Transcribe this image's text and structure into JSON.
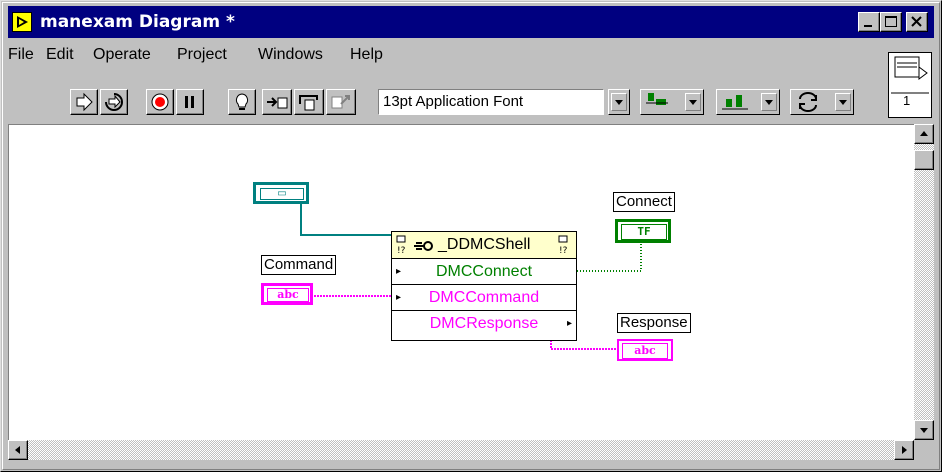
{
  "window": {
    "title": "manexam Diagram *"
  },
  "menu": {
    "items": [
      "File",
      "Edit",
      "Operate",
      "Project",
      "Windows",
      "Help"
    ]
  },
  "toolbar": {
    "icons": [
      "run-icon",
      "run-continuously-icon",
      "abort-icon",
      "pause-icon",
      "highlight-execution-icon",
      "step-into-icon",
      "step-over-icon",
      "step-out-icon"
    ],
    "font_value": "13pt Application Font"
  },
  "connector": {
    "number": "1"
  },
  "diagram": {
    "labels": {
      "connect": "Connect",
      "command": "Command",
      "response": "Response"
    },
    "terminals": {
      "refnum": "▭",
      "bool": "TF",
      "string_in": "abc",
      "string_out": "abc"
    },
    "node": {
      "title": "_DDMCShell",
      "methods": [
        "DMCConnect",
        "DMCCommand",
        "DMCResponse"
      ]
    },
    "colors": {
      "refnum": "#008080",
      "boolean": "#008000",
      "string": "#ff00ff",
      "header": "#ffffcc"
    }
  }
}
